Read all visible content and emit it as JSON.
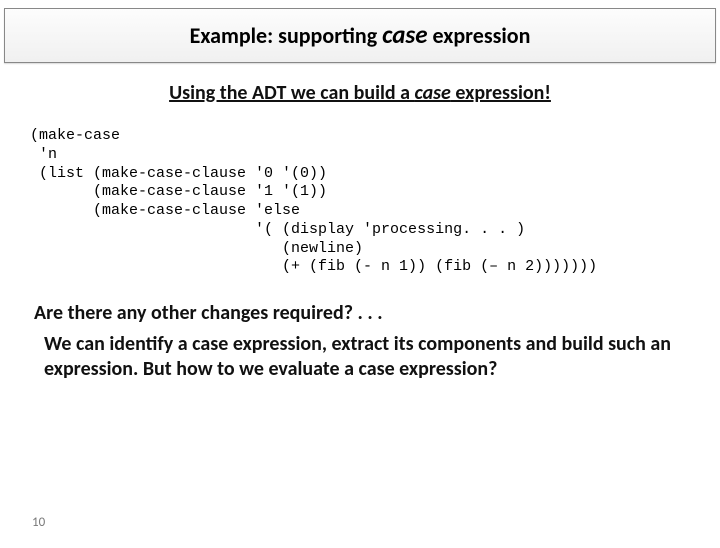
{
  "title": {
    "pre": "Example: supporting ",
    "keyword": "case",
    "post": " expression"
  },
  "subtitle": {
    "pre": "Using the ADT we can build a ",
    "keyword": "case",
    "post": " expression!"
  },
  "code": "(make-case\n 'n\n (list (make-case-clause '0 '(0))\n       (make-case-clause '1 '(1))\n       (make-case-clause 'else\n                         '( (display 'processing. . . )\n                            (newline)\n                            (+ (fib (- n 1)) (fib (– n 2)))))))",
  "question": "Are there any other changes required? . . .",
  "answer": "We can identify a case expression, extract its components and build such an expression. But how to we evaluate a case expression?",
  "page_number": "10"
}
